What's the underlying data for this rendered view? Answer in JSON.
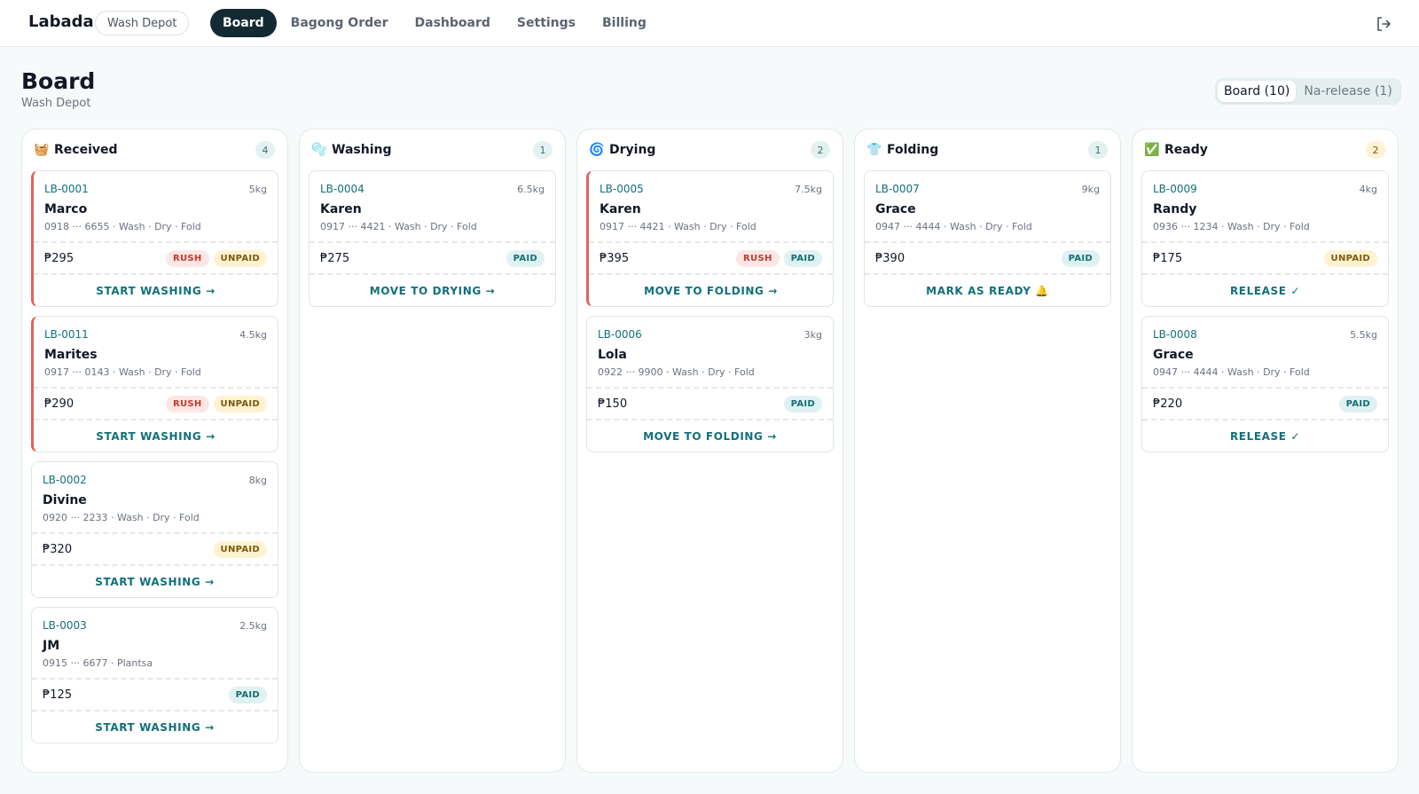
{
  "app": {
    "brand": "Labada",
    "shop": "Wash Depot"
  },
  "nav": [
    {
      "label": "Board",
      "active": true
    },
    {
      "label": "Bagong Order",
      "active": false
    },
    {
      "label": "Dashboard",
      "active": false
    },
    {
      "label": "Settings",
      "active": false
    },
    {
      "label": "Billing",
      "active": false
    }
  ],
  "header": {
    "title": "Board",
    "subtitle": "Wash Depot"
  },
  "views": [
    {
      "label": "Board (10)",
      "active": true
    },
    {
      "label": "Na-release (1)",
      "active": false
    }
  ],
  "columns": [
    {
      "icon": "🧺",
      "icon_name": "basket-icon",
      "title": "Received",
      "count": "4",
      "cards": [
        {
          "id": "LB-0001",
          "weight": "5kg",
          "name": "Marco",
          "meta": "0918 ··· 6655  ·  Wash · Dry · Fold",
          "price": "₱295",
          "rush": true,
          "paid": false,
          "rush_label": "RUSH",
          "pay_label": "UNPAID",
          "action": "START WASHING →"
        },
        {
          "id": "LB-0011",
          "weight": "4.5kg",
          "name": "Marites",
          "meta": "0917 ··· 0143  ·  Wash · Dry · Fold",
          "price": "₱290",
          "rush": true,
          "paid": false,
          "rush_label": "RUSH",
          "pay_label": "UNPAID",
          "action": "START WASHING →"
        },
        {
          "id": "LB-0002",
          "weight": "8kg",
          "name": "Divine",
          "meta": "0920 ··· 2233  ·  Wash · Dry · Fold",
          "price": "₱320",
          "rush": false,
          "paid": false,
          "pay_label": "UNPAID",
          "action": "START WASHING →"
        },
        {
          "id": "LB-0003",
          "weight": "2.5kg",
          "name": "JM",
          "meta": "0915 ··· 6677  ·  Plantsa",
          "price": "₱125",
          "rush": false,
          "paid": true,
          "pay_label": "PAID",
          "action": "START WASHING →"
        }
      ]
    },
    {
      "icon": "🫧",
      "icon_name": "bubbles-icon",
      "title": "Washing",
      "count": "1",
      "cards": [
        {
          "id": "LB-0004",
          "weight": "6.5kg",
          "name": "Karen",
          "meta": "0917 ··· 4421  ·  Wash · Dry · Fold",
          "price": "₱275",
          "rush": false,
          "paid": true,
          "pay_label": "PAID",
          "action": "MOVE TO DRYING →"
        }
      ]
    },
    {
      "icon": "🌀",
      "icon_name": "cyclone-icon",
      "title": "Drying",
      "count": "2",
      "cards": [
        {
          "id": "LB-0005",
          "weight": "7.5kg",
          "name": "Karen",
          "meta": "0917 ··· 4421  ·  Wash · Dry · Fold",
          "price": "₱395",
          "rush": true,
          "paid": true,
          "rush_label": "RUSH",
          "pay_label": "PAID",
          "action": "MOVE TO FOLDING →"
        },
        {
          "id": "LB-0006",
          "weight": "3kg",
          "name": "Lola",
          "meta": "0922 ··· 9900  ·  Wash · Dry · Fold",
          "price": "₱150",
          "rush": false,
          "paid": true,
          "pay_label": "PAID",
          "action": "MOVE TO FOLDING →"
        }
      ]
    },
    {
      "icon": "👕",
      "icon_name": "shirt-icon",
      "title": "Folding",
      "count": "1",
      "cards": [
        {
          "id": "LB-0007",
          "weight": "9kg",
          "name": "Grace",
          "meta": "0947 ··· 4444  ·  Wash · Dry · Fold",
          "price": "₱390",
          "rush": false,
          "paid": true,
          "pay_label": "PAID",
          "action": "MARK AS READY 🔔"
        }
      ]
    },
    {
      "icon": "✅",
      "icon_name": "check-mark-icon",
      "title": "Ready",
      "count": "2",
      "count_style": "amber",
      "cards": [
        {
          "id": "LB-0009",
          "weight": "4kg",
          "name": "Randy",
          "meta": "0936 ··· 1234  ·  Wash · Dry · Fold",
          "price": "₱175",
          "rush": false,
          "paid": false,
          "pay_label": "UNPAID",
          "action": "RELEASE ✓"
        },
        {
          "id": "LB-0008",
          "weight": "5.5kg",
          "name": "Grace",
          "meta": "0947 ··· 4444  ·  Wash · Dry · Fold",
          "price": "₱220",
          "rush": false,
          "paid": true,
          "pay_label": "PAID",
          "action": "RELEASE ✓"
        }
      ]
    }
  ],
  "colors": {
    "accent": "#12707a",
    "nav_active": "#132a33",
    "rush": "#e5615b"
  }
}
